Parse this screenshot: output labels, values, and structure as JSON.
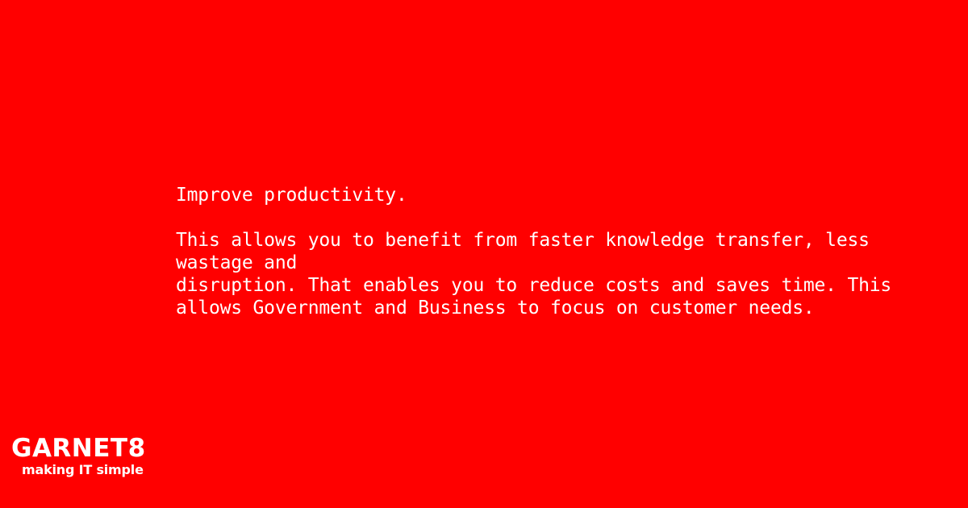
{
  "headline": "Improve productivity.",
  "body_lines": [
    "This allows you to benefit from faster knowledge transfer, less",
    "wastage and",
    "disruption. That enables you to reduce costs and saves time. This",
    "allows Government and Business to focus on customer needs."
  ],
  "logo": {
    "wordmark": "GARNET8",
    "tagline": "making IT simple"
  },
  "colors": {
    "background": "#ff0000",
    "text": "#ffffff"
  }
}
